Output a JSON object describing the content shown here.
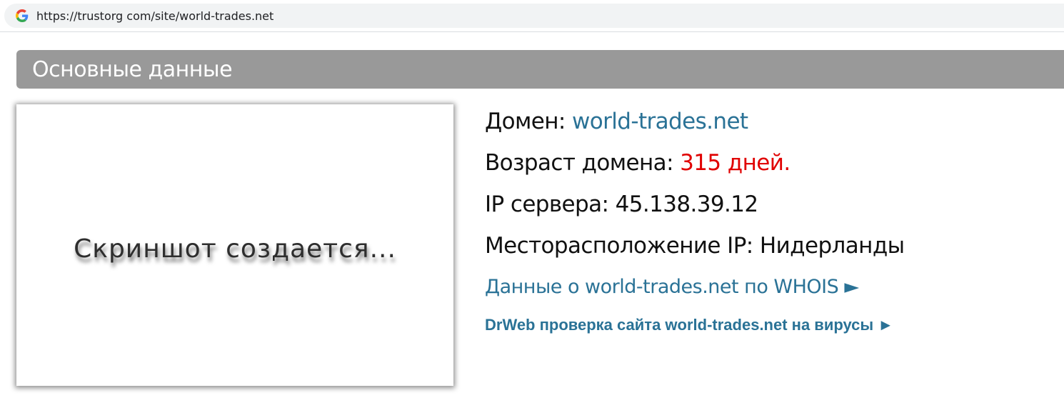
{
  "browser": {
    "url": "https://trustorg com/site/world-trades.net",
    "icon": "google-g-icon"
  },
  "section": {
    "title": "Основные данные"
  },
  "screenshot": {
    "placeholder": "Скриншот создается..."
  },
  "info": {
    "domain_label": "Домен: ",
    "domain_value": "world-trades.net",
    "age_label": "Возраст домена: ",
    "age_value": "315 дней.",
    "ip_label": "IP сервера: ",
    "ip_value": "45.138.39.12",
    "location_label": "Месторасположение IP: ",
    "location_value": "Нидерланды",
    "whois_link": "Данные о world-trades.net по WHOIS ►",
    "drweb_link": "DrWeb проверка сайта world-trades.net на вирусы ►"
  },
  "colors": {
    "header_bg": "#999999",
    "link": "#2a7296",
    "age_red": "#e00000"
  }
}
